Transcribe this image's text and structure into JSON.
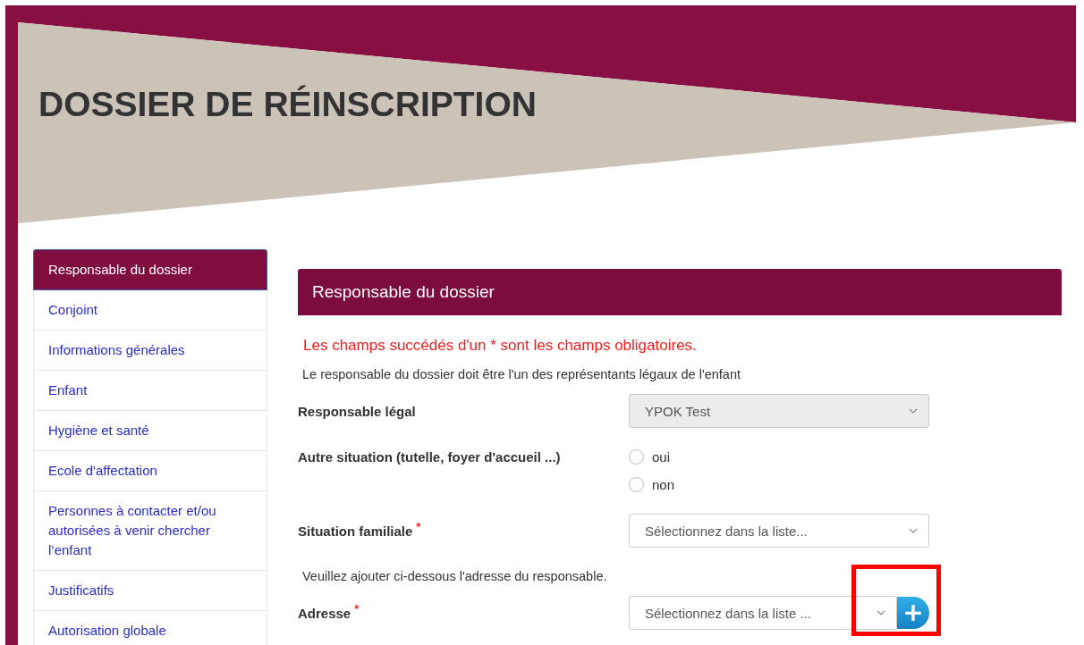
{
  "title": "DOSSIER DE RÉINSCRIPTION",
  "sidebar": {
    "items": [
      {
        "label": "Responsable du dossier",
        "selected": true
      },
      {
        "label": "Conjoint",
        "selected": false
      },
      {
        "label": "Informations générales",
        "selected": false
      },
      {
        "label": "Enfant",
        "selected": false
      },
      {
        "label": "Hygiène et santé",
        "selected": false
      },
      {
        "label": "Ecole d'affectation",
        "selected": false
      },
      {
        "label": "Personnes à contacter et/ou autorisées à venir chercher l’enfant",
        "selected": false
      },
      {
        "label": "Justificatifs",
        "selected": false
      },
      {
        "label": "Autorisation globale",
        "selected": false
      }
    ]
  },
  "panel": {
    "title": "Responsable du dossier",
    "required_note": "Les champs succédés d'un * sont les champs obligatoires.",
    "fields": [
      {
        "kind": "note",
        "text": "Le responsable du dossier doit être l'un des représentants légaux de l'enfant"
      },
      {
        "kind": "select",
        "label": "Responsable légal",
        "value": "YPOK Test",
        "disabled": true
      },
      {
        "kind": "radio",
        "label": "Autre situation (tutelle, foyer d'accueil ...)",
        "options": [
          {
            "label": "oui",
            "selected": false
          },
          {
            "label": "non",
            "selected": false
          }
        ]
      },
      {
        "kind": "select",
        "label": "Situation familiale",
        "required_mark": "*",
        "placeholder": "Sélectionnez dans la liste...",
        "disabled": false
      },
      {
        "kind": "note",
        "text": "Veuillez ajouter ci-dessous l'adresse du responsable."
      },
      {
        "kind": "select_add",
        "label": "Adresse",
        "required_mark": "*",
        "placeholder": "Sélectionnez dans la liste ...",
        "disabled": false,
        "add_button": "+"
      }
    ]
  }
}
